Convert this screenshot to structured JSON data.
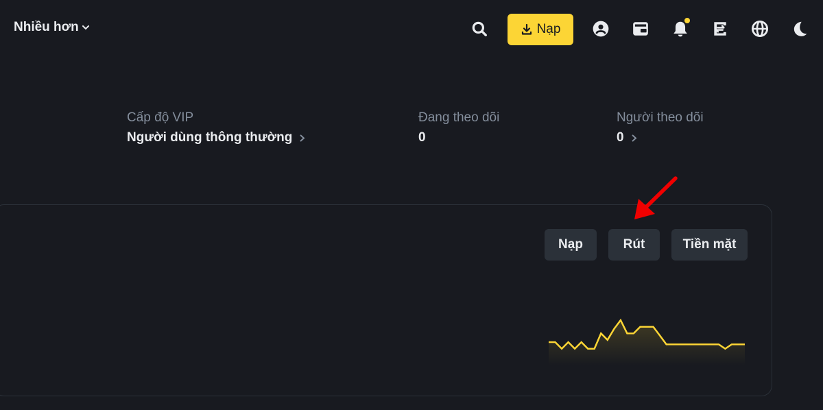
{
  "header": {
    "more_label": "Nhiều hơn",
    "deposit_label": "Nạp",
    "icons": [
      "search-icon",
      "user-icon",
      "wallet-icon",
      "bell-icon",
      "transfer-icon",
      "globe-icon",
      "moon-icon"
    ]
  },
  "profile": {
    "vip": {
      "label": "Cấp độ VIP",
      "value": "Người dùng thông thường"
    },
    "following": {
      "label": "Đang theo dõi",
      "value": "0"
    },
    "followers": {
      "label": "Người theo dõi",
      "value": "0"
    }
  },
  "balance_panel": {
    "deposit_label": "Nạp",
    "withdraw_label": "Rút",
    "cash_label": "Tiền mặt"
  },
  "sparkline": {
    "values": [
      5,
      5,
      2,
      5,
      2,
      5,
      2,
      2,
      9,
      6,
      11,
      15,
      9,
      9,
      12,
      12,
      12,
      8,
      4,
      4,
      4,
      4,
      4,
      4,
      4,
      4,
      4,
      2,
      4,
      4,
      4
    ],
    "color": "#fcd535"
  },
  "colors": {
    "accent": "#fcd535",
    "background": "#181a20",
    "button": "#2b3139",
    "annotation": "#f00000"
  }
}
